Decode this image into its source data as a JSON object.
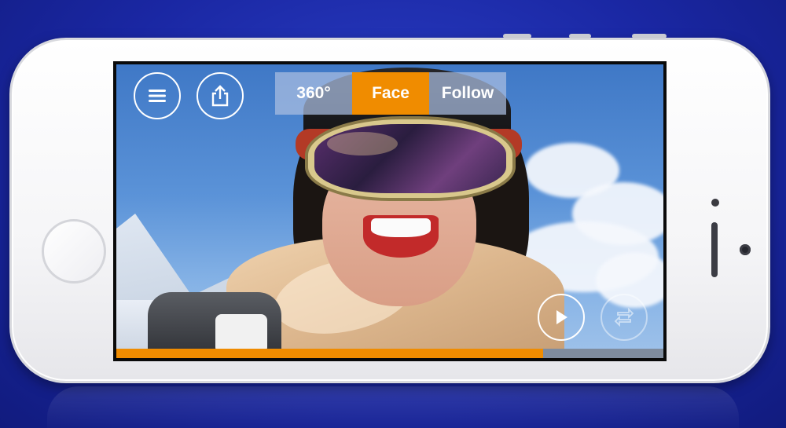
{
  "view_modes": {
    "items": [
      {
        "label": "360°",
        "active": false
      },
      {
        "label": "Face",
        "active": true
      },
      {
        "label": "Follow",
        "active": false
      }
    ]
  },
  "controls": {
    "menu_icon": "hamburger-menu-icon",
    "share_icon": "share-icon",
    "play_icon": "play-icon",
    "rotate_icon": "rotate-camera-icon"
  },
  "playback": {
    "progress": 0.78
  },
  "colors": {
    "accent": "#f08c00",
    "background": "#1a27a3",
    "segment_inactive": "#aabee1"
  }
}
